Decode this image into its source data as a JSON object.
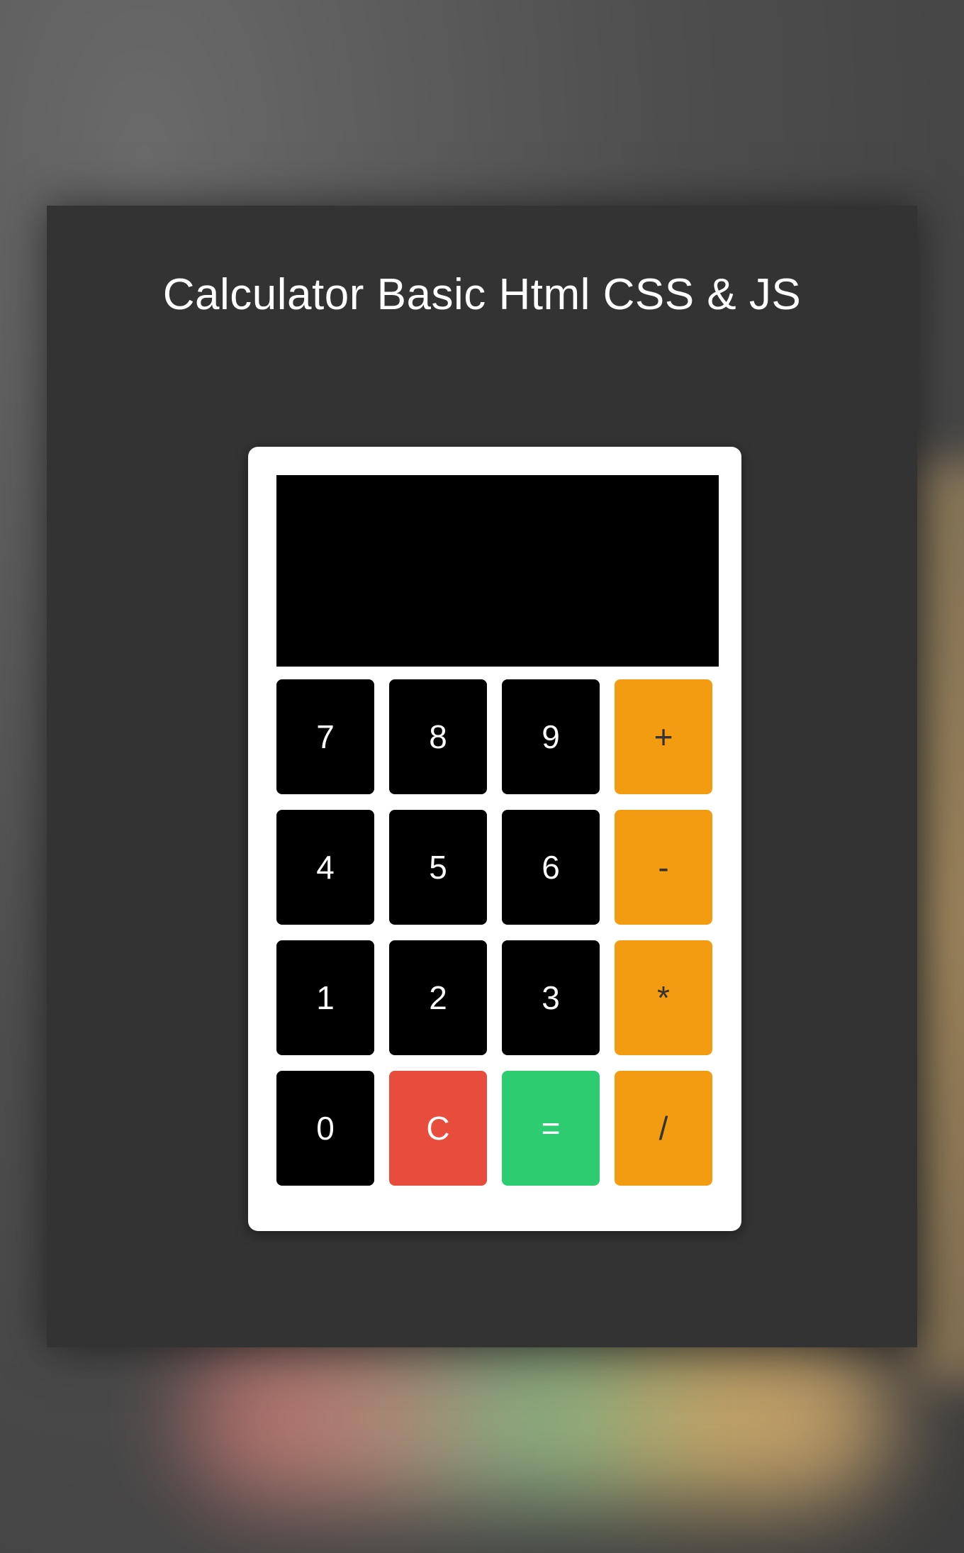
{
  "title": "Calculator Basic Html CSS & JS",
  "display": {
    "value": ""
  },
  "keys": {
    "k7": "7",
    "k8": "8",
    "k9": "9",
    "plus": "+",
    "k4": "4",
    "k5": "5",
    "k6": "6",
    "minus": "-",
    "k1": "1",
    "k2": "2",
    "k3": "3",
    "multiply": "*",
    "k0": "0",
    "clear": "C",
    "equals": "=",
    "divide": "/"
  },
  "colors": {
    "page_background": "#333333",
    "calculator_body": "#ffffff",
    "display": "#000000",
    "digit_key": "#000000",
    "operator_key": "#f39c12",
    "clear_key": "#e74c3c",
    "equals_key": "#2ecc71"
  }
}
